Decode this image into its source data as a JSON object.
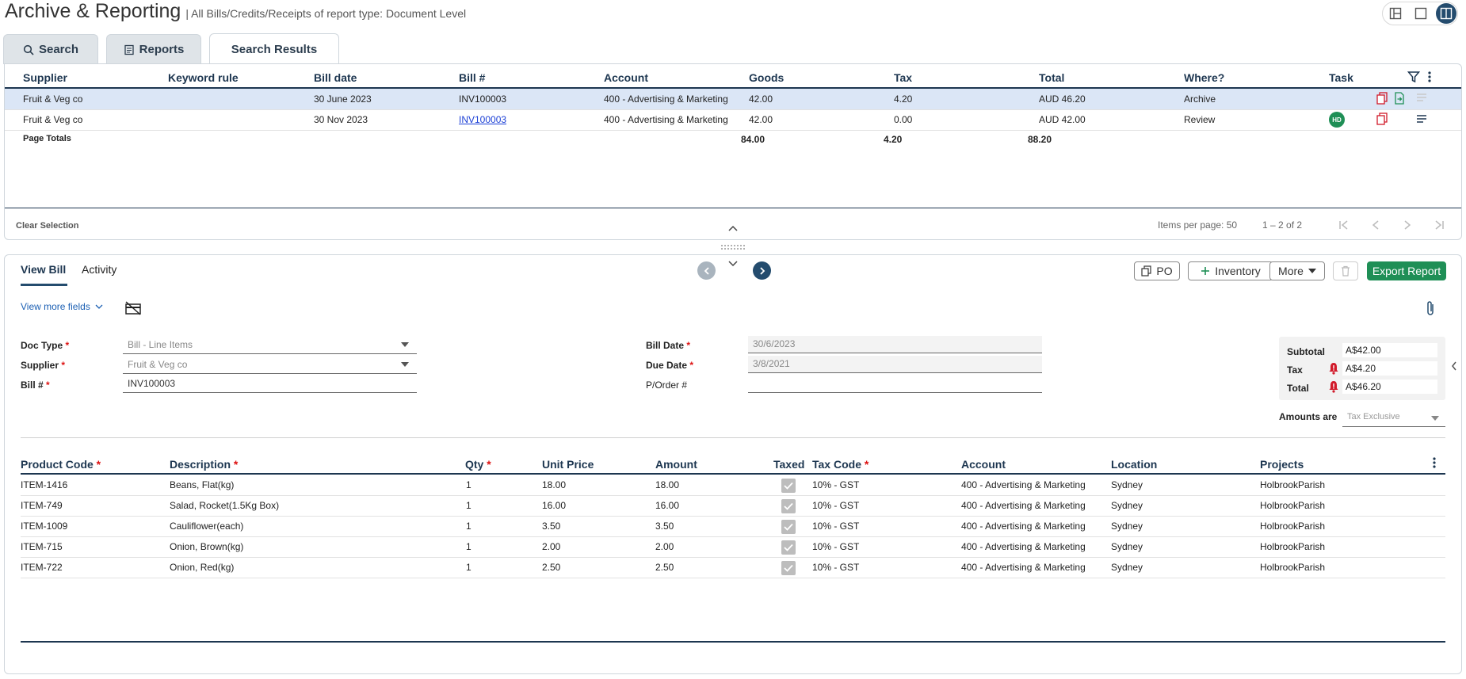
{
  "header": {
    "title": "Archive & Reporting",
    "subtitle": "| All Bills/Credits/Receipts of report type: Document Level"
  },
  "tabs": [
    {
      "label": "Search",
      "icon": "search-icon"
    },
    {
      "label": "Reports",
      "icon": "report-icon"
    },
    {
      "label": "Search Results"
    }
  ],
  "results": {
    "columns": [
      "Supplier",
      "Keyword rule",
      "Bill date",
      "Bill #",
      "Account",
      "Goods",
      "Tax",
      "Total",
      "Where?",
      "Task"
    ],
    "rows": [
      {
        "supplier": "Fruit & Veg co",
        "keyword": "",
        "bill_date": "30 June 2023",
        "bill_no": "INV100003",
        "account": "400 - Advertising & Marketing",
        "goods": "42.00",
        "tax": "4.20",
        "total": "AUD 46.20",
        "where": "Archive"
      },
      {
        "supplier": "Fruit & Veg co",
        "keyword": "",
        "bill_date": "30 Nov 2023",
        "bill_no": "INV100003",
        "account": "400 - Advertising & Marketing",
        "goods": "42.00",
        "tax": "0.00",
        "total": "AUD 42.00",
        "where": "Review",
        "badge": "HD"
      }
    ],
    "totals": {
      "label": "Page Totals",
      "goods": "84.00",
      "tax": "4.20",
      "total": "88.20"
    },
    "footer": {
      "clear": "Clear Selection",
      "items_per_page": "Items per page: 50",
      "range": "1 – 2 of 2"
    }
  },
  "bill": {
    "tabs": [
      "View Bill",
      "Activity"
    ],
    "buttons": {
      "po": "PO",
      "inventory": "Inventory",
      "more": "More",
      "export": "Export Report"
    },
    "view_more": "View more fields",
    "fields": {
      "doc_type_label": "Doc Type",
      "doc_type": "Bill - Line Items",
      "supplier_label": "Supplier",
      "supplier": "Fruit & Veg co",
      "bill_no_label": "Bill #",
      "bill_no": "INV100003",
      "bill_date_label": "Bill Date",
      "bill_date": "30/6/2023",
      "due_date_label": "Due Date",
      "due_date": "3/8/2021",
      "po_label": "P/Order #",
      "po": ""
    },
    "summary": {
      "subtotal_label": "Subtotal",
      "subtotal": "A$42.00",
      "tax_label": "Tax",
      "tax": "A$4.20",
      "total_label": "Total",
      "total": "A$46.20",
      "amounts_label": "Amounts are",
      "amounts": "Tax Exclusive"
    },
    "line_columns": [
      "Product Code",
      "Description",
      "Qty",
      "Unit Price",
      "Amount",
      "Taxed",
      "Tax Code",
      "Account",
      "Location",
      "Projects"
    ],
    "lines": [
      {
        "code": "ITEM-1416",
        "desc": "Beans, Flat(kg)",
        "qty": "1",
        "price": "18.00",
        "amount": "18.00",
        "tax_code": "10% - GST",
        "account": "400 - Advertising & Marketing",
        "location": "Sydney",
        "project": "HolbrookParish"
      },
      {
        "code": "ITEM-749",
        "desc": "Salad, Rocket(1.5Kg Box)",
        "qty": "1",
        "price": "16.00",
        "amount": "16.00",
        "tax_code": "10% - GST",
        "account": "400 - Advertising & Marketing",
        "location": "Sydney",
        "project": "HolbrookParish"
      },
      {
        "code": "ITEM-1009",
        "desc": "Cauliflower(each)",
        "qty": "1",
        "price": "3.50",
        "amount": "3.50",
        "tax_code": "10% - GST",
        "account": "400 - Advertising & Marketing",
        "location": "Sydney",
        "project": "HolbrookParish"
      },
      {
        "code": "ITEM-715",
        "desc": "Onion, Brown(kg)",
        "qty": "1",
        "price": "2.00",
        "amount": "2.00",
        "tax_code": "10% - GST",
        "account": "400 - Advertising & Marketing",
        "location": "Sydney",
        "project": "HolbrookParish"
      },
      {
        "code": "ITEM-722",
        "desc": "Onion, Red(kg)",
        "qty": "1",
        "price": "2.50",
        "amount": "2.50",
        "tax_code": "10% - GST",
        "account": "400 - Advertising & Marketing",
        "location": "Sydney",
        "project": "HolbrookParish"
      }
    ]
  },
  "colors": {
    "accent": "#244c6e",
    "green": "#1f8f56",
    "selected_row": "#dbe6f6",
    "alert": "#d11a2a"
  }
}
